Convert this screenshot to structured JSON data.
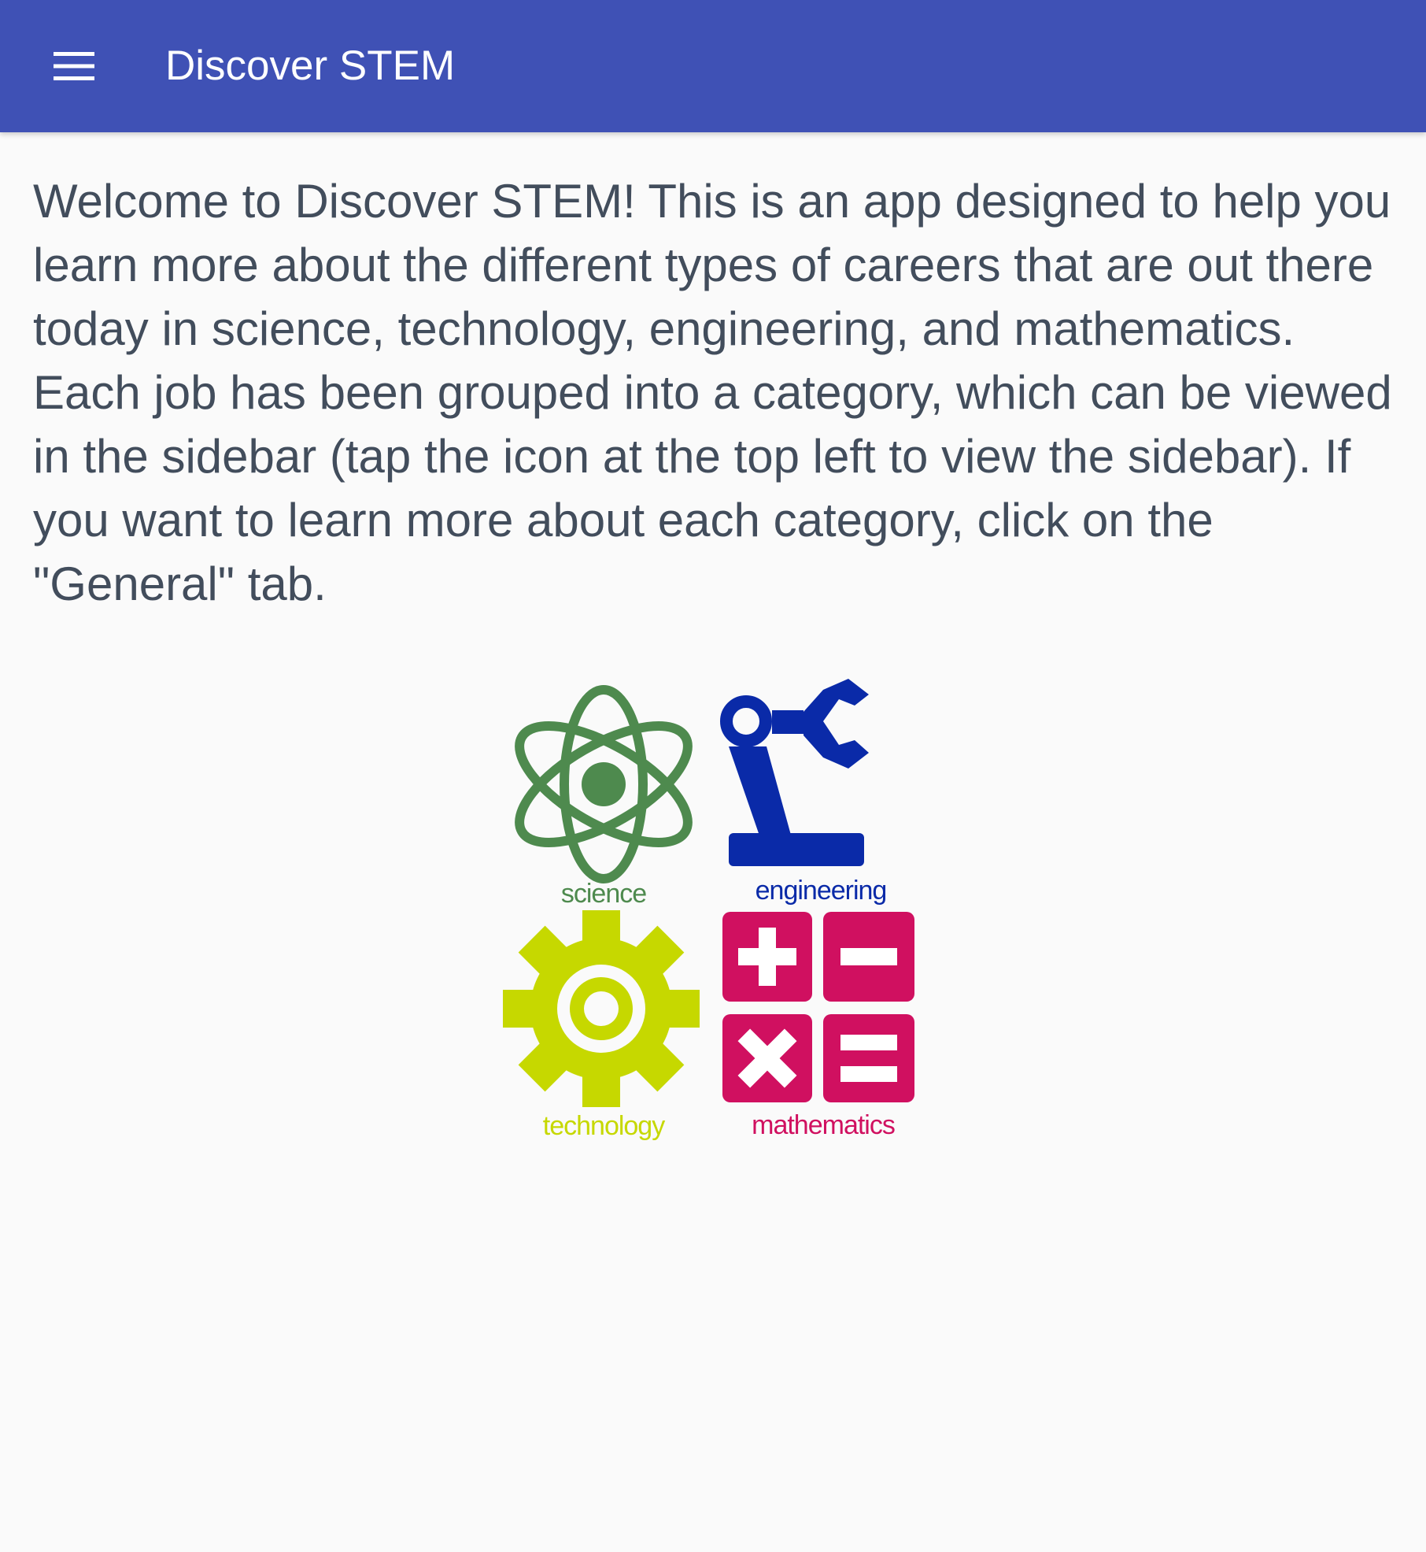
{
  "header": {
    "menu_icon": "hamburger-menu-icon",
    "title": "Discover STEM"
  },
  "main": {
    "welcome_text": "Welcome to Discover STEM! This is an app designed to help you learn more about the different types of careers that are out there today in science, technology, engineering, and mathematics. Each job has been grouped into a category, which can be viewed in the sidebar (tap the icon at the top left to view the sidebar). If you want to learn more about each category, click on the \"General\" tab.",
    "logo": {
      "science_label": "science",
      "engineering_label": "engineering",
      "technology_label": "technology",
      "mathematics_label": "mathematics",
      "icons": [
        "atom-icon",
        "robot-arm-icon",
        "gear-icon",
        "math-operators-icon"
      ]
    }
  },
  "colors": {
    "appbar": "#3f51b5",
    "background": "#fafafa",
    "body_text": "#424d5c",
    "science": "#4e8a4e",
    "engineering": "#0a2aa8",
    "technology": "#c6d800",
    "mathematics": "#d01060"
  }
}
